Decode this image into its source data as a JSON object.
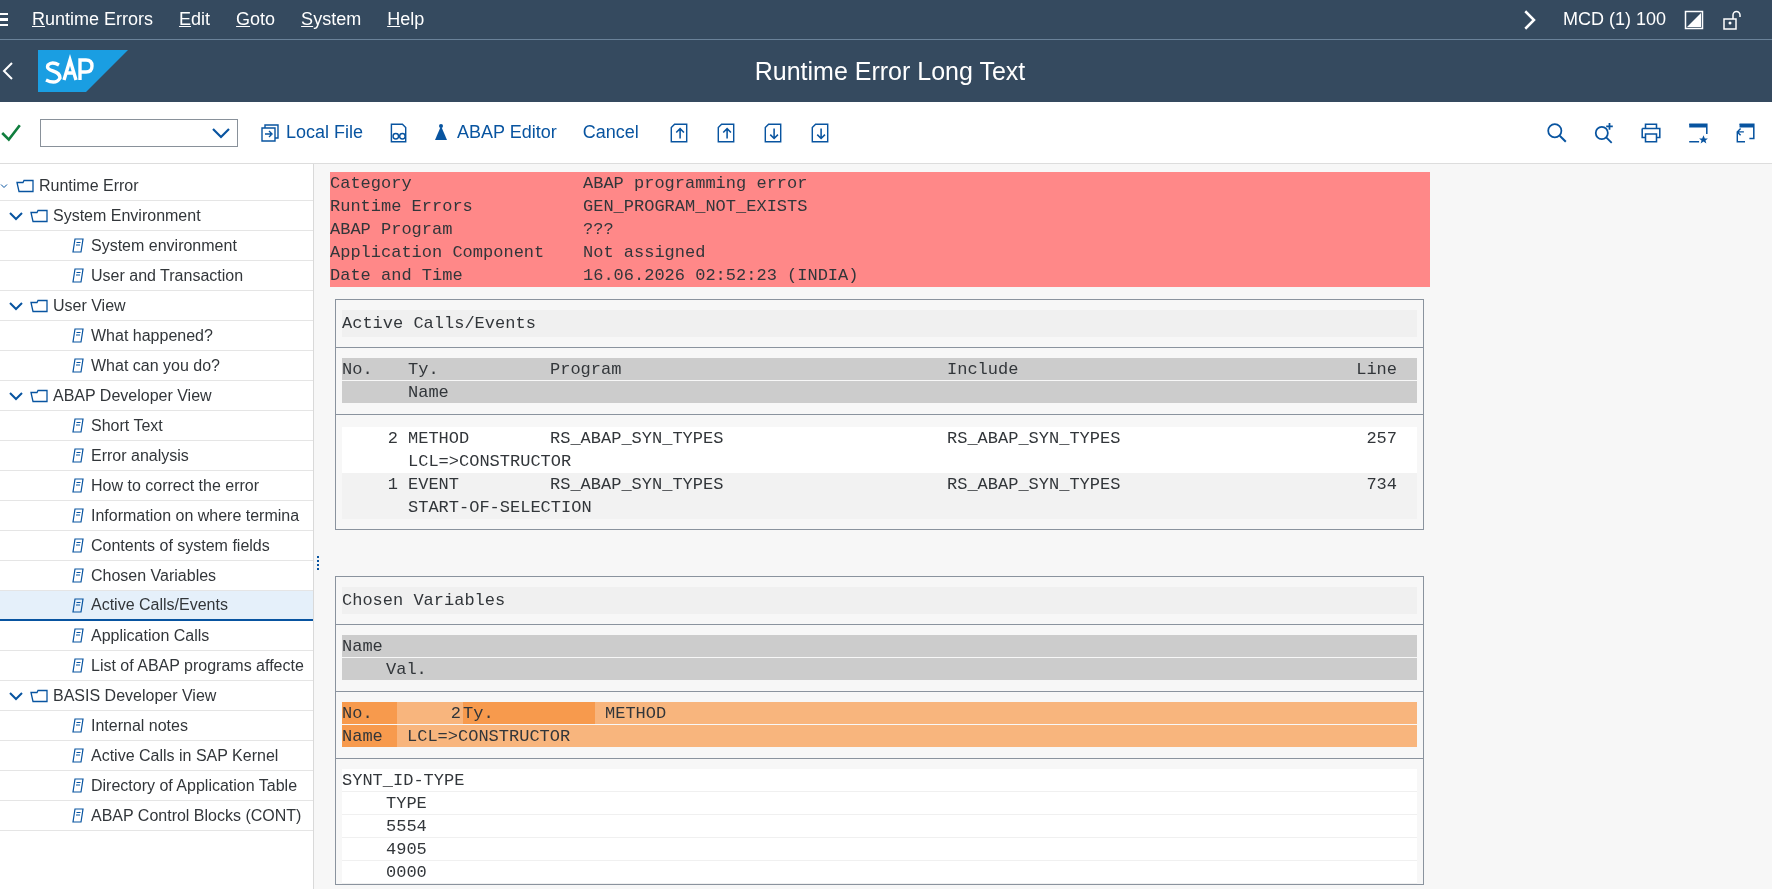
{
  "menu_bar": {
    "items": [
      "Runtime Errors",
      "Edit",
      "Goto",
      "System",
      "Help"
    ],
    "system": "MCD (1) 100"
  },
  "title": "Runtime Error Long Text",
  "toolbar": {
    "labels": [
      "Local File",
      "ABAP Editor",
      "Cancel"
    ]
  },
  "tree": [
    {
      "label": "Runtime Error",
      "expanded": true,
      "children": [
        {
          "label": "System Environment",
          "expanded": true,
          "children": [
            {
              "label": "System environment",
              "selected": false
            },
            {
              "label": "User and Transaction",
              "selected": false
            }
          ]
        },
        {
          "label": "User View",
          "expanded": true,
          "children": [
            {
              "label": "What happened?",
              "selected": false
            },
            {
              "label": "What can you do?",
              "selected": false
            }
          ]
        },
        {
          "label": "ABAP Developer View",
          "expanded": true,
          "children": [
            {
              "label": "Short Text",
              "selected": false
            },
            {
              "label": "Error analysis",
              "selected": false
            },
            {
              "label": "How to correct the error",
              "selected": false
            },
            {
              "label": "Information on where termina",
              "selected": false
            },
            {
              "label": "Contents of system fields",
              "selected": false
            },
            {
              "label": "Chosen Variables",
              "selected": false
            },
            {
              "label": "Active Calls/Events",
              "selected": true
            },
            {
              "label": "Application Calls",
              "selected": false
            },
            {
              "label": "List of ABAP programs affecte",
              "selected": false
            }
          ]
        },
        {
          "label": "BASIS Developer View",
          "expanded": true,
          "children": [
            {
              "label": "Internal notes",
              "selected": false
            },
            {
              "label": "Active Calls in SAP Kernel",
              "selected": false
            },
            {
              "label": "Directory of Application Table",
              "selected": false
            },
            {
              "label": "ABAP Control Blocks (CONT)",
              "selected": false
            }
          ]
        }
      ]
    }
  ],
  "header_fields": [
    {
      "label": "Category",
      "value": "ABAP programming error"
    },
    {
      "label": "Runtime Errors",
      "value": "GEN_PROGRAM_NOT_EXISTS"
    },
    {
      "label": "ABAP Program",
      "value": "???"
    },
    {
      "label": "Application Component",
      "value": "Not assigned"
    },
    {
      "label": "Date and Time",
      "value": "16.06.2026 02:52:23 (INDIA)"
    }
  ],
  "active_calls": {
    "title": "Active Calls/Events",
    "columns": [
      "No.",
      "Ty.",
      "Program",
      "Include",
      "Line"
    ],
    "subcolumn": "Name",
    "rows": [
      {
        "no": "2",
        "type": "METHOD",
        "program": "RS_ABAP_SYN_TYPES",
        "include": "RS_ABAP_SYN_TYPES",
        "line": "257",
        "name": "LCL=>CONSTRUCTOR"
      },
      {
        "no": "1",
        "type": "EVENT",
        "program": "RS_ABAP_SYN_TYPES",
        "include": "RS_ABAP_SYN_TYPES",
        "line": "734",
        "name": "START-OF-SELECTION"
      }
    ]
  },
  "chosen_variables": {
    "title": "Chosen Variables",
    "column": "Name",
    "subcolumn": "Val.",
    "call": {
      "no_label": "No.",
      "no": "2",
      "type_label": "Ty.",
      "type": "METHOD",
      "name_label": "Name",
      "name": "LCL=>CONSTRUCTOR"
    },
    "variables": [
      {
        "name": "SYNT_ID-TYPE",
        "lines": [
          "TYPE",
          "5554",
          "4905",
          "0000"
        ]
      }
    ]
  }
}
